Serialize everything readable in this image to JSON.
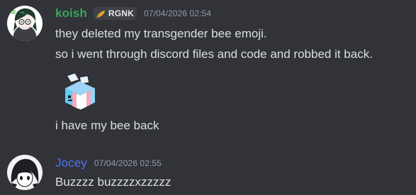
{
  "messages": [
    {
      "author": "koish",
      "author_color": "#3ba55d",
      "server_tag": "RGNK",
      "tag_icon": "golden-feather-icon",
      "timestamp": "07/04/2026 02:54",
      "lines": [
        "they deleted my transgender bee emoji.",
        "so i went through discord files and code and robbed it back.",
        "i have my bee back"
      ],
      "emoji": "transgender-bee-emoji"
    },
    {
      "author": "Jocey",
      "author_color": "#3e63dd",
      "timestamp": "07/04/2026 02:55",
      "lines": [
        "Buzzzz buzzzzxzzzzz"
      ]
    }
  ]
}
